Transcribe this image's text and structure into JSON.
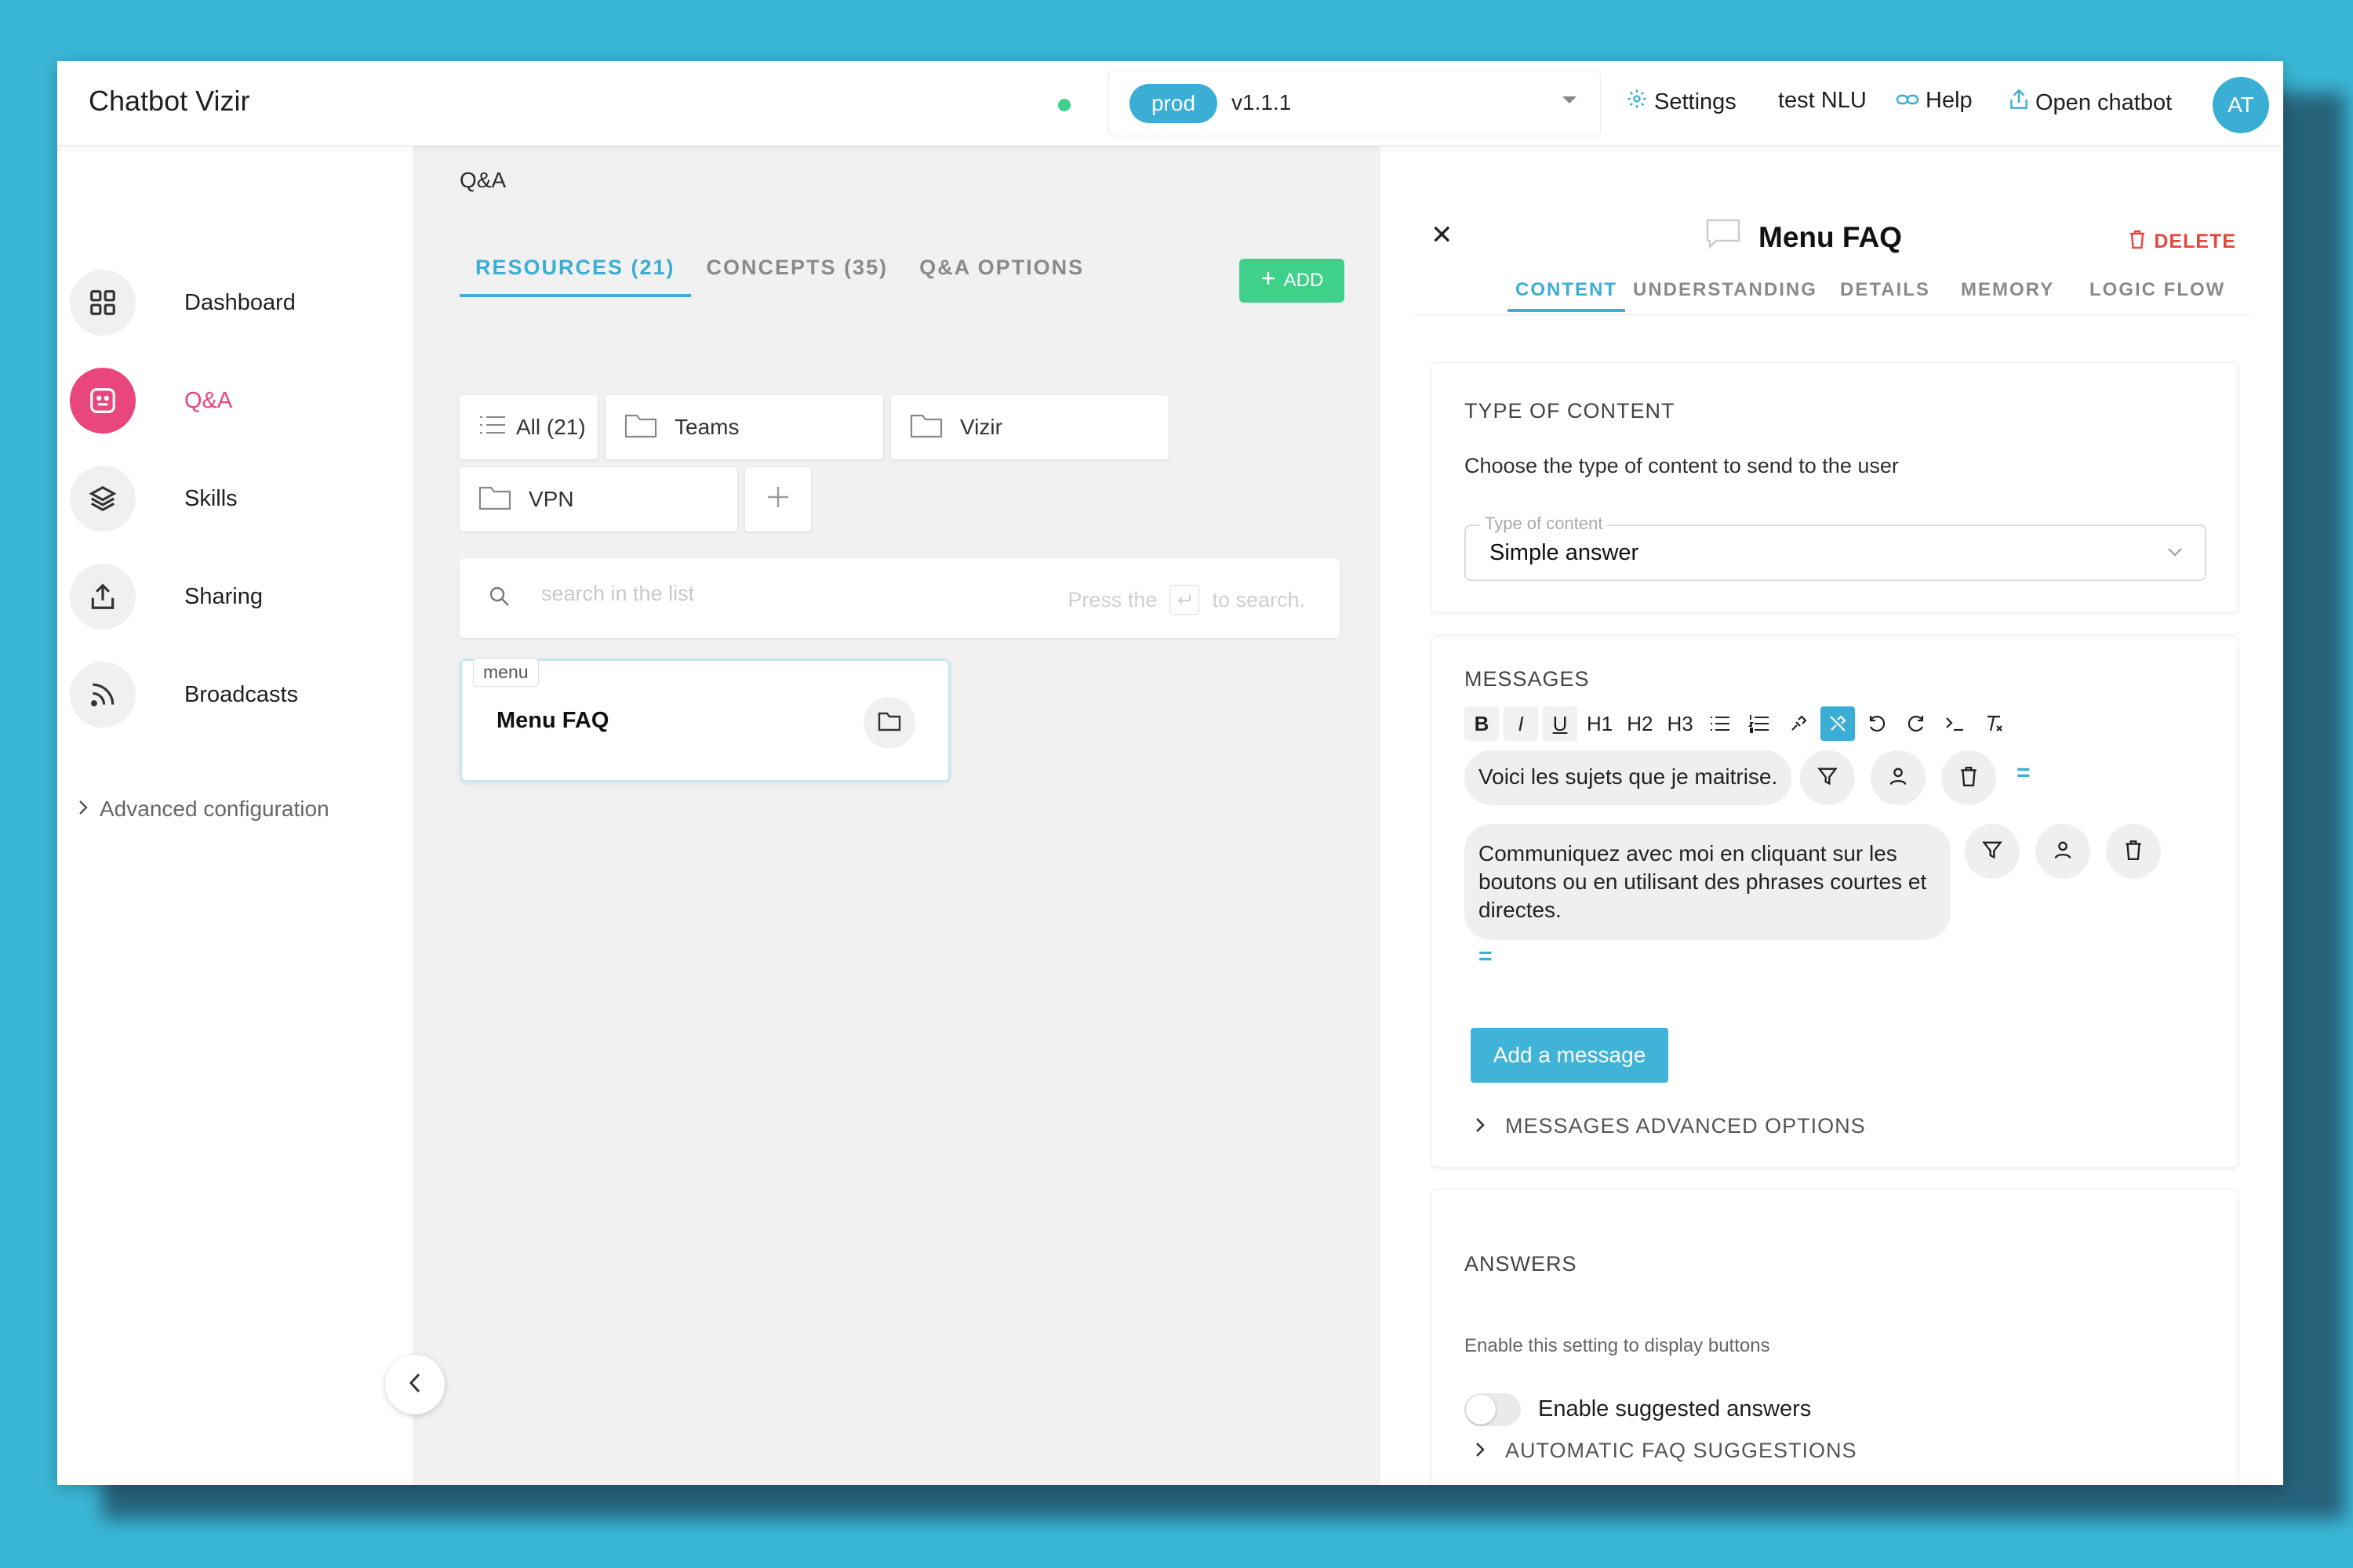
{
  "header": {
    "app_title": "Chatbot Vizir",
    "env": {
      "pill": "prod",
      "version": "v1.1.1"
    },
    "links": {
      "settings": "Settings",
      "test_nlu": "test NLU",
      "help": "Help",
      "open_chatbot": "Open chatbot"
    },
    "avatar_initials": "AT"
  },
  "sidebar": {
    "items": [
      {
        "label": "Dashboard",
        "icon": "grid-icon"
      },
      {
        "label": "Q&A",
        "icon": "qa-icon"
      },
      {
        "label": "Skills",
        "icon": "layers-icon"
      },
      {
        "label": "Sharing",
        "icon": "share-icon"
      },
      {
        "label": "Broadcasts",
        "icon": "rss-icon"
      }
    ],
    "advanced_config": "Advanced configuration"
  },
  "middle": {
    "breadcrumb": "Q&A",
    "tabs": [
      {
        "label": "RESOURCES (21)",
        "active": true
      },
      {
        "label": "CONCEPTS (35)",
        "active": false
      },
      {
        "label": "Q&A OPTIONS",
        "active": false
      }
    ],
    "add_label": "ADD",
    "folders": {
      "all": "All (21)",
      "teams": "Teams",
      "vizir": "Vizir",
      "vpn": "VPN"
    },
    "search": {
      "placeholder": "search in the list",
      "hint_before": "Press the",
      "hint_after": "to search."
    },
    "card": {
      "tag": "menu",
      "title": "Menu FAQ"
    }
  },
  "panel": {
    "title": "Menu FAQ",
    "delete_label": "DELETE",
    "tabs": [
      "CONTENT",
      "UNDERSTANDING",
      "DETAILS",
      "MEMORY",
      "LOGIC FLOW"
    ],
    "content_type": {
      "title": "TYPE OF CONTENT",
      "description": "Choose the type of content to send to the user",
      "legend": "Type of content",
      "value": "Simple answer"
    },
    "messages": {
      "title": "MESSAGES",
      "toolbar": {
        "bold": "B",
        "italic": "I",
        "underline": "U",
        "h1": "H1",
        "h2": "H2",
        "h3": "H3"
      },
      "items": [
        "Voici les sujets que je maitrise.",
        "Communiquez avec moi en cliquant sur les boutons ou en utilisant des phrases courtes et directes."
      ],
      "add_button": "Add a message",
      "advanced_options": "MESSAGES ADVANCED OPTIONS"
    },
    "answers": {
      "title": "ANSWERS",
      "description": "Enable this setting to display buttons",
      "toggle_label": "Enable suggested answers",
      "faq_suggestions": "AUTOMATIC FAQ SUGGESTIONS"
    }
  },
  "colors": {
    "accent": "#3aaed4",
    "active_nav": "#e8467c",
    "add_green": "#3fd08a",
    "delete_red": "#e5473c",
    "background": "#3ab7d6"
  }
}
